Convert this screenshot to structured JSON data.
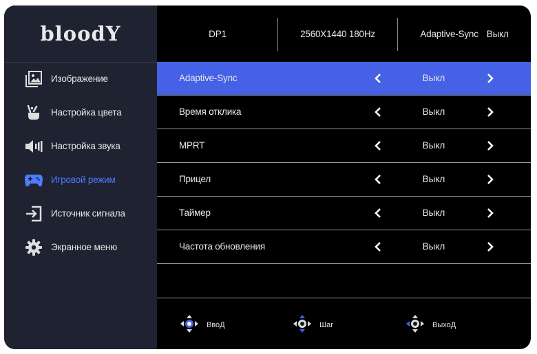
{
  "brand": {
    "logo_text": "bloodY"
  },
  "header": {
    "input": "DP1",
    "resolution": "2560X1440 180Hz",
    "feature_label": "Adaptive-Sync",
    "feature_value": "Выкл"
  },
  "sidebar": {
    "items": [
      {
        "label": "Изображение",
        "icon": "image-icon"
      },
      {
        "label": "Настройка цвета",
        "icon": "color-settings-icon"
      },
      {
        "label": "Настройка звука",
        "icon": "speaker-icon"
      },
      {
        "label": "Игровой режим",
        "icon": "gamepad-icon",
        "active": true
      },
      {
        "label": "Источник сигнала",
        "icon": "input-source-icon"
      },
      {
        "label": "Экранное меню",
        "icon": "gear-icon"
      }
    ]
  },
  "settings": {
    "rows": [
      {
        "name": "Adaptive-Sync",
        "value": "Выкл",
        "active": true
      },
      {
        "name": "Время отклика",
        "value": "Выкл"
      },
      {
        "name": "MPRT",
        "value": "Выкл"
      },
      {
        "name": "Прицел",
        "value": "Выкл"
      },
      {
        "name": "Таймер",
        "value": "Выкл"
      },
      {
        "name": "Частота обновления",
        "value": "Выкл"
      }
    ]
  },
  "footer": {
    "hints": [
      {
        "label": "ВвоД",
        "icon": "joystick-enter-icon"
      },
      {
        "label": "Шаг",
        "icon": "joystick-step-icon"
      },
      {
        "label": "ВыхоД",
        "icon": "joystick-exit-icon"
      }
    ]
  },
  "colors": {
    "accent": "#4561e6",
    "active_text": "#4e7cff",
    "sidebar_bg": "#1e2231",
    "panel_bg": "#000000"
  }
}
